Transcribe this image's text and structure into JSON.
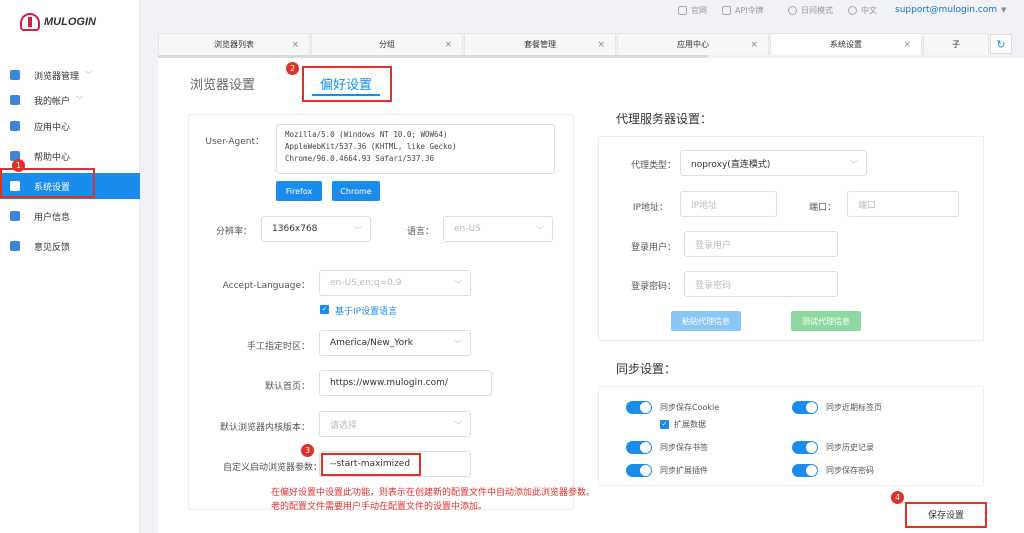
{
  "app": {
    "logo_text": "MULOGIN"
  },
  "topbar": {
    "home": "官网",
    "api": "API令牌",
    "daymode": "日间模式",
    "lang": "中文",
    "support": "support@mulogin.com",
    "support_caret": "▼"
  },
  "sidebar": {
    "items": [
      {
        "label": "浏览器管理",
        "chev": "﹀",
        "icon": "browser-icon"
      },
      {
        "label": "我的帐户",
        "chev": "﹀",
        "icon": "account-icon"
      },
      {
        "label": "应用中心",
        "icon": "apps-icon"
      },
      {
        "label": "帮助中心",
        "icon": "help-icon"
      },
      {
        "label": "系统设置",
        "icon": "settings-icon"
      },
      {
        "label": "用户信息",
        "icon": "user-icon"
      },
      {
        "label": "意见反馈",
        "icon": "feedback-icon"
      }
    ]
  },
  "tabs": [
    {
      "label": "浏览器列表",
      "close": "×"
    },
    {
      "label": "分组",
      "close": "×"
    },
    {
      "label": "套餐管理",
      "close": "×"
    },
    {
      "label": "应用中心",
      "close": "×"
    },
    {
      "label": "系统设置",
      "close": "×"
    },
    {
      "label": "子",
      "close": ""
    }
  ],
  "refresh_icon": "↻",
  "page": {
    "tab_browser": "浏览器设置",
    "tab_pref": "偏好设置"
  },
  "form": {
    "ua_label": "User-Agent：",
    "ua_value": "Mozilla/5.0 (Windows NT 10.0; WOW64)\nAppleWebKit/537.36 (KHTML, like Gecko)\nChrome/96.0.4664.93 Safari/537.36",
    "btn_firefox": "Firefox",
    "btn_chrome": "Chrome",
    "res_label": "分辨率：",
    "res_value": "1366x768",
    "lang_label": "语言：",
    "lang_value": "en-US",
    "accept_label": "Accept-Language：",
    "accept_value": "en-US,en;q=0.9",
    "ip_lang_chk": "基于IP设置语言",
    "tz_label": "手工指定时区：",
    "tz_value": "America/New_York",
    "home_label": "默认首页：",
    "home_value": "https://www.mulogin.com/",
    "kernel_label": "默认浏览器内核版本：",
    "kernel_placeholder": "请选择",
    "args_label": "自定义启动浏览器参数：",
    "args_value": "--start-maximized",
    "arrow": "﹀"
  },
  "proxy": {
    "title": "代理服务器设置：",
    "type_label": "代理类型：",
    "type_value": "noproxy(直连模式)",
    "ip_label": "IP地址：",
    "ip_placeholder": "IP地址",
    "port_label": "端口：",
    "port_placeholder": "端口",
    "user_label": "登录用户：",
    "user_placeholder": "登录用户",
    "pass_label": "登录密码：",
    "pass_placeholder": "登录密码",
    "btn_paste": "粘贴代理信息",
    "btn_test": "测试代理信息"
  },
  "sync": {
    "title": "同步设置：",
    "cookie": "同步保存Cookie",
    "ext_data": "扩展数据",
    "bookmark": "同步保存书签",
    "extension": "同步扩展插件",
    "recent_tabs": "同步近期标签页",
    "history": "同步历史记录",
    "password": "同步保存密码"
  },
  "save_button": "保存设置",
  "annotations": {
    "badge1": "1",
    "badge2": "2",
    "badge3": "3",
    "badge4": "4",
    "note_line1": "在偏好设置中设置此功能，则表示在创建新的配置文件中自动添加此浏览器参数。",
    "note_line2": "老的配置文件需要用户手动在配置文件的设置中添加。"
  },
  "colors": {
    "accent": "#1a8ceb",
    "annotation": "#e0302a",
    "logo": "#d81e45"
  }
}
